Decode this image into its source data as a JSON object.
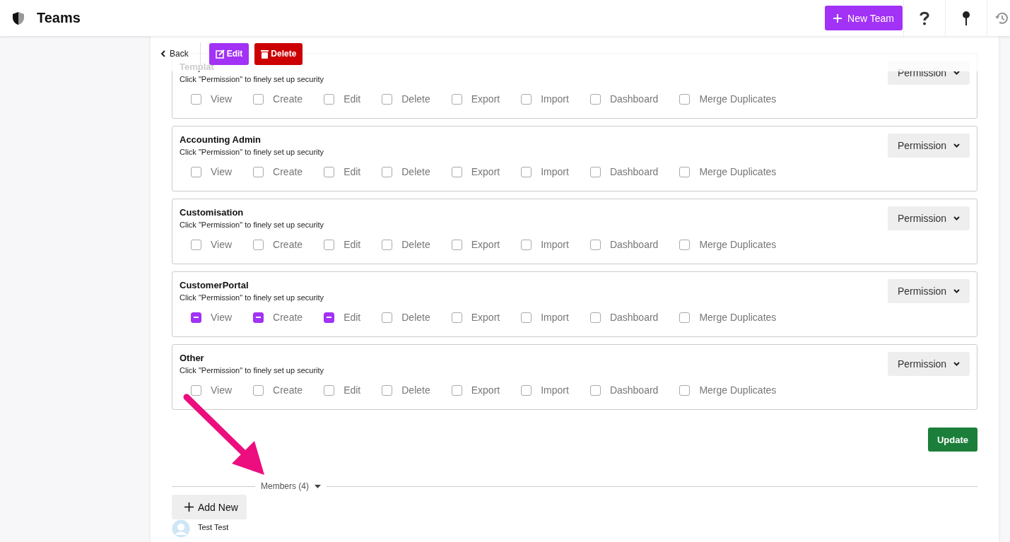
{
  "header": {
    "title": "Teams",
    "new_button": "New Team"
  },
  "toolbar": {
    "back": "Back",
    "edit": "Edit",
    "delete": "Delete"
  },
  "permission_groups": [
    {
      "title": "Templat",
      "hint": "Click \"Permission\" to finely set up security",
      "button": "Permission",
      "options": [
        {
          "label": "View",
          "partial": false
        },
        {
          "label": "Create",
          "partial": false
        },
        {
          "label": "Edit",
          "partial": false
        },
        {
          "label": "Delete",
          "partial": false
        },
        {
          "label": "Export",
          "partial": false
        },
        {
          "label": "Import",
          "partial": false
        },
        {
          "label": "Dashboard",
          "partial": false
        },
        {
          "label": "Merge Duplicates",
          "partial": false
        }
      ]
    },
    {
      "title": "Accounting Admin",
      "hint": "Click \"Permission\" to finely set up security",
      "button": "Permission",
      "options": [
        {
          "label": "View",
          "partial": false
        },
        {
          "label": "Create",
          "partial": false
        },
        {
          "label": "Edit",
          "partial": false
        },
        {
          "label": "Delete",
          "partial": false
        },
        {
          "label": "Export",
          "partial": false
        },
        {
          "label": "Import",
          "partial": false
        },
        {
          "label": "Dashboard",
          "partial": false
        },
        {
          "label": "Merge Duplicates",
          "partial": false
        }
      ]
    },
    {
      "title": "Customisation",
      "hint": "Click \"Permission\" to finely set up security",
      "button": "Permission",
      "options": [
        {
          "label": "View",
          "partial": false
        },
        {
          "label": "Create",
          "partial": false
        },
        {
          "label": "Edit",
          "partial": false
        },
        {
          "label": "Delete",
          "partial": false
        },
        {
          "label": "Export",
          "partial": false
        },
        {
          "label": "Import",
          "partial": false
        },
        {
          "label": "Dashboard",
          "partial": false
        },
        {
          "label": "Merge Duplicates",
          "partial": false
        }
      ]
    },
    {
      "title": "CustomerPortal",
      "hint": "Click \"Permission\" to finely set up security",
      "button": "Permission",
      "options": [
        {
          "label": "View",
          "partial": true
        },
        {
          "label": "Create",
          "partial": true
        },
        {
          "label": "Edit",
          "partial": true
        },
        {
          "label": "Delete",
          "partial": false
        },
        {
          "label": "Export",
          "partial": false
        },
        {
          "label": "Import",
          "partial": false
        },
        {
          "label": "Dashboard",
          "partial": false
        },
        {
          "label": "Merge Duplicates",
          "partial": false
        }
      ]
    },
    {
      "title": "Other",
      "hint": "Click \"Permission\" to finely set up security",
      "button": "Permission",
      "options": [
        {
          "label": "View",
          "partial": false
        },
        {
          "label": "Create",
          "partial": false
        },
        {
          "label": "Edit",
          "partial": false
        },
        {
          "label": "Delete",
          "partial": false
        },
        {
          "label": "Export",
          "partial": false
        },
        {
          "label": "Import",
          "partial": false
        },
        {
          "label": "Dashboard",
          "partial": false
        },
        {
          "label": "Merge Duplicates",
          "partial": false
        }
      ]
    }
  ],
  "update_button": "Update",
  "members": {
    "heading": "Members (4)",
    "add_button": "Add New",
    "list": [
      {
        "name": "Test Test"
      }
    ]
  }
}
